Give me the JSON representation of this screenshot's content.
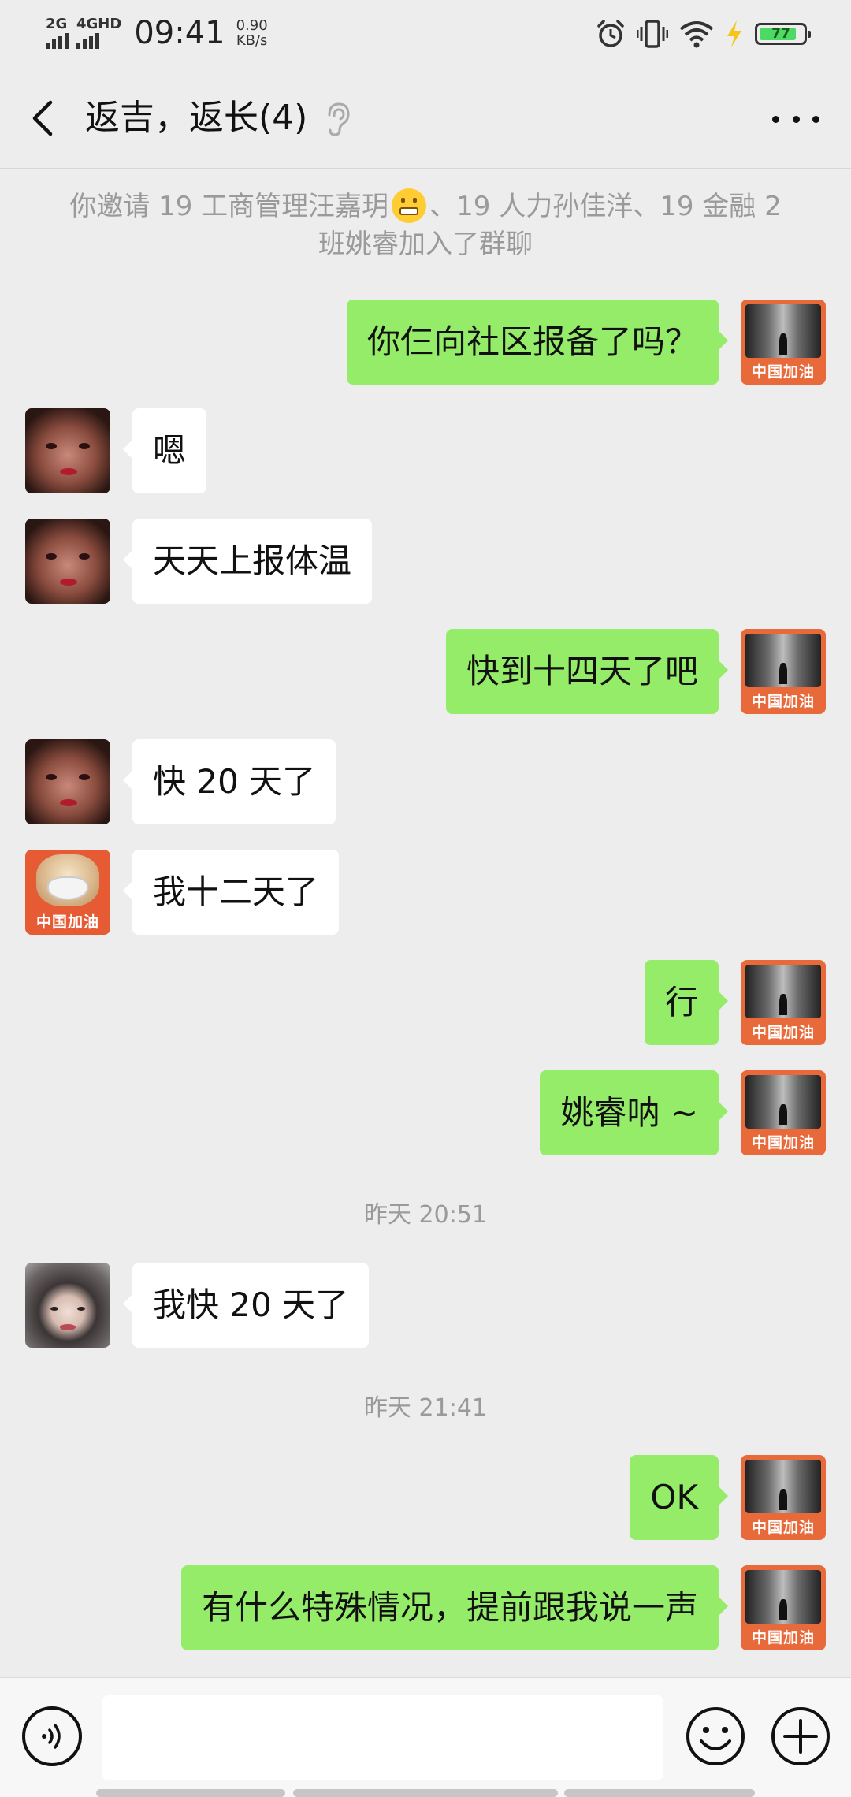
{
  "status_bar": {
    "sig1_label": "2G",
    "sig2_label": "4GHD",
    "time": "09:41",
    "speed_value": "0.90",
    "speed_unit": "KB/s",
    "battery_level": "77",
    "icons": [
      "alarm-icon",
      "vibrate-icon",
      "wifi-icon",
      "charging-icon",
      "battery-icon"
    ]
  },
  "header": {
    "title": "返吉，返长(4)",
    "back_icon": "chevron-left-icon",
    "muted_icon": "ear-icon",
    "more_icon": "more-icon"
  },
  "system_message": {
    "part1": "你邀请 19 工商管理汪嘉玥",
    "emoji": "grimacing-face",
    "part2": "、19 人力孙佳洋、19 金融 2 班姚睿加入了群聊"
  },
  "timestamps": [
    "昨天 20:51",
    "昨天 21:41"
  ],
  "messages": [
    {
      "side": "me",
      "text": "你仨向社区报备了吗？",
      "avatar_caption": "中国加油"
    },
    {
      "side": "them",
      "text": "嗯",
      "avatar": "girl-red-lips"
    },
    {
      "side": "them",
      "text": "天天上报体温",
      "avatar": "girl-red-lips"
    },
    {
      "side": "me",
      "text": "快到十四天了吧",
      "avatar_caption": "中国加油"
    },
    {
      "side": "them",
      "text": "快 20 天了",
      "avatar": "girl-red-lips"
    },
    {
      "side": "them",
      "text": "我十二天了",
      "avatar": "masked-dog",
      "avatar_caption": "中国加油"
    },
    {
      "side": "me",
      "text": "行",
      "avatar_caption": "中国加油"
    },
    {
      "side": "me",
      "text": "姚睿呐 ~",
      "avatar_caption": "中国加油"
    },
    {
      "side": "them",
      "text": "我快 20 天了",
      "avatar": "hooded-girl"
    },
    {
      "side": "me",
      "text": "OK",
      "avatar_caption": "中国加油"
    },
    {
      "side": "me",
      "text": "有什么特殊情况，提前跟我说一声",
      "avatar_caption": "中国加油"
    }
  ],
  "input_bar": {
    "voice_icon": "voice-icon",
    "text_value": "",
    "emoji_icon": "emoji-icon",
    "plus_icon": "plus-icon"
  },
  "colors": {
    "background": "#ededed",
    "my_bubble": "#95ec69",
    "their_bubble": "#ffffff",
    "battery": "#4cd964",
    "avatar_red": "#e86a3a"
  }
}
